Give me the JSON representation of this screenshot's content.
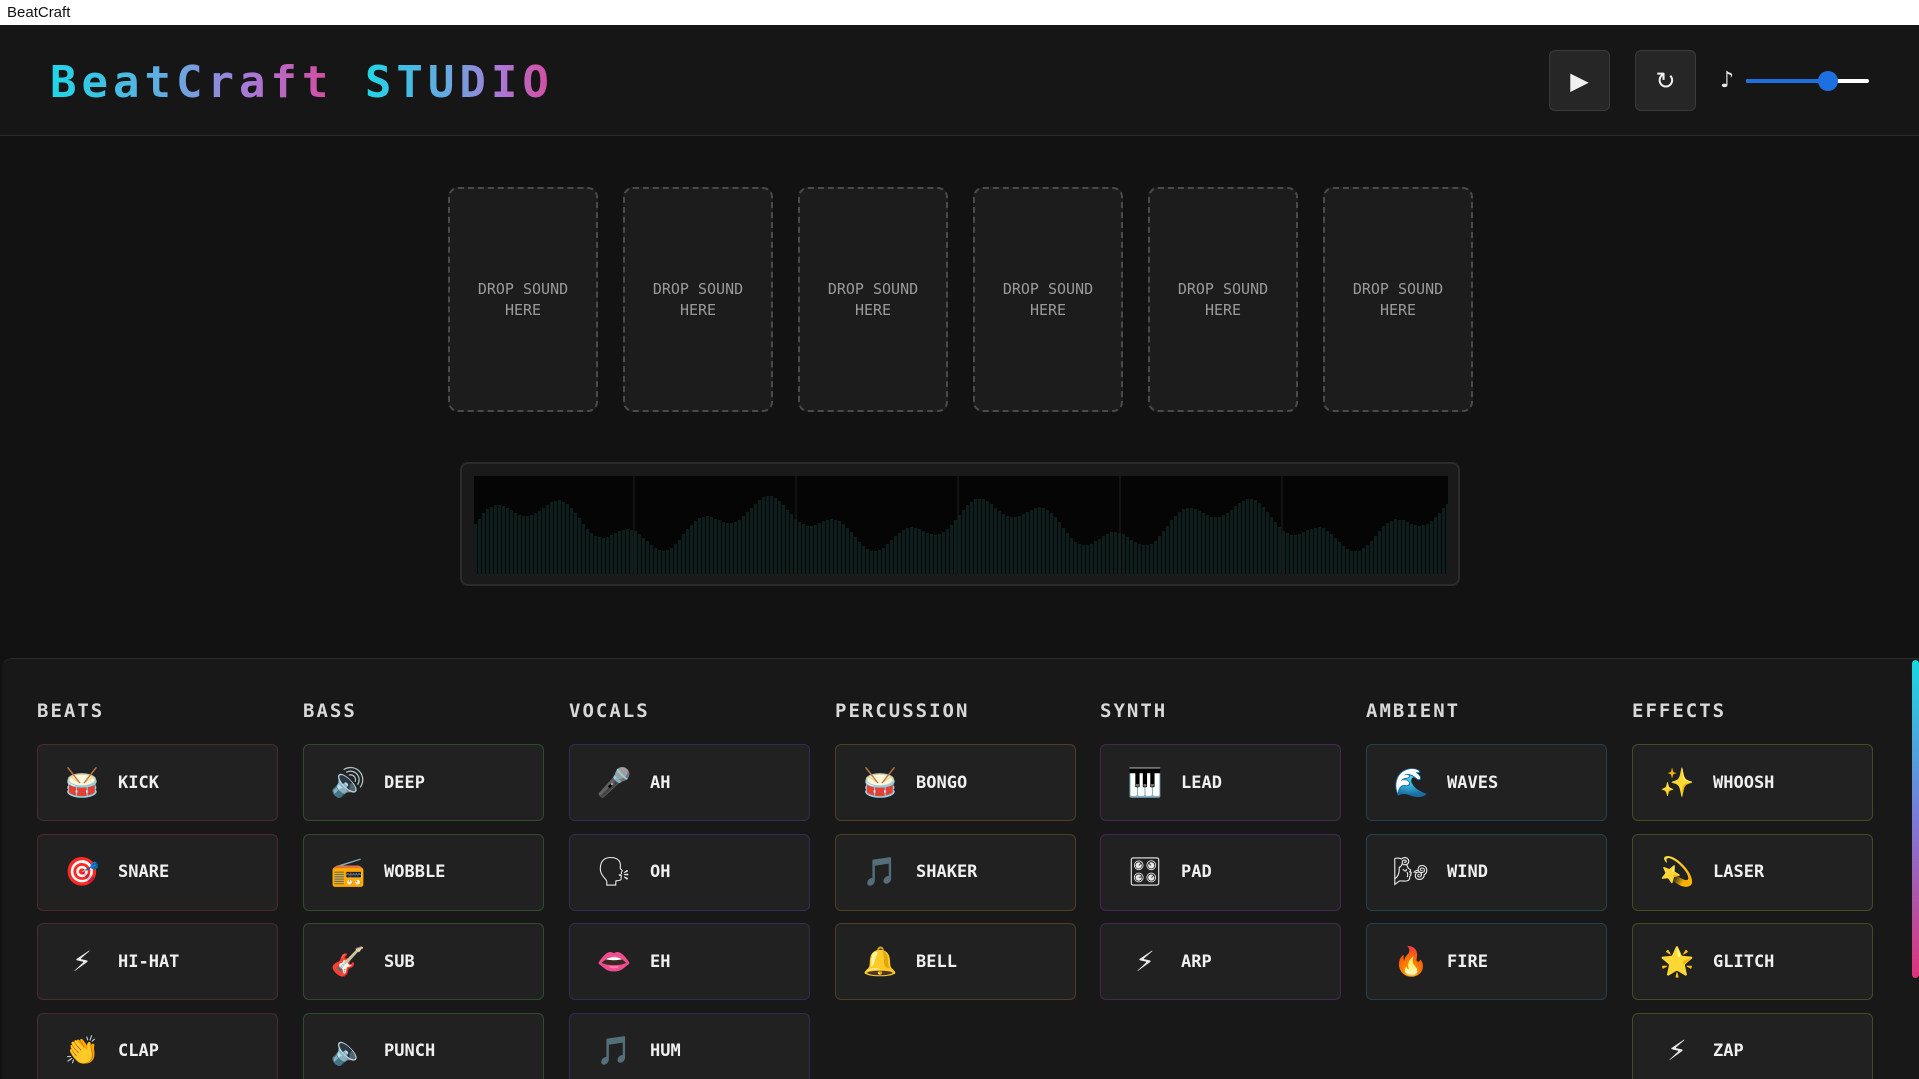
{
  "window": {
    "title": "BeatCraft"
  },
  "header": {
    "logo_part1": "BeatCraft",
    "logo_part2": "STUDIO",
    "play_icon": "▶",
    "reset_icon": "↻",
    "volume_icon": "♪",
    "volume_level": 0.67,
    "accent": "#1e6fe0"
  },
  "slots": [
    {
      "label": "DROP SOUND HERE"
    },
    {
      "label": "DROP SOUND HERE"
    },
    {
      "label": "DROP SOUND HERE"
    },
    {
      "label": "DROP SOUND HERE"
    },
    {
      "label": "DROP SOUND HERE"
    },
    {
      "label": "DROP SOUND HERE"
    }
  ],
  "categories": [
    {
      "title": "BEATS",
      "color": "#4a2b2b",
      "sounds": [
        {
          "label": "KICK",
          "icon": "🥁"
        },
        {
          "label": "SNARE",
          "icon": "🎯"
        },
        {
          "label": "HI-HAT",
          "icon": "⚡"
        },
        {
          "label": "CLAP",
          "icon": "👏"
        }
      ]
    },
    {
      "title": "BASS",
      "color": "#2f4a2f",
      "sounds": [
        {
          "label": "DEEP",
          "icon": "🔊"
        },
        {
          "label": "WOBBLE",
          "icon": "📻"
        },
        {
          "label": "SUB",
          "icon": "🎸"
        },
        {
          "label": "PUNCH",
          "icon": "🔈"
        }
      ]
    },
    {
      "title": "VOCALS",
      "color": "#2e2e52",
      "sounds": [
        {
          "label": "AH",
          "icon": "🎤"
        },
        {
          "label": "OH",
          "icon": "🗣"
        },
        {
          "label": "EH",
          "icon": "👄"
        },
        {
          "label": "HUM",
          "icon": "🎵"
        }
      ]
    },
    {
      "title": "PERCUSSION",
      "color": "#4e3f24",
      "sounds": [
        {
          "label": "BONGO",
          "icon": "🥁"
        },
        {
          "label": "SHAKER",
          "icon": "🎵"
        },
        {
          "label": "BELL",
          "icon": "🔔"
        }
      ]
    },
    {
      "title": "SYNTH",
      "color": "#42294e",
      "sounds": [
        {
          "label": "LEAD",
          "icon": "🎹"
        },
        {
          "label": "PAD",
          "icon": "🎛"
        },
        {
          "label": "ARP",
          "icon": "⚡"
        }
      ]
    },
    {
      "title": "AMBIENT",
      "color": "#25404a",
      "sounds": [
        {
          "label": "WAVES",
          "icon": "🌊"
        },
        {
          "label": "WIND",
          "icon": "🌬"
        },
        {
          "label": "FIRE",
          "icon": "🔥"
        }
      ]
    },
    {
      "title": "EFFECTS",
      "color": "#454a25",
      "sounds": [
        {
          "label": "WHOOSH",
          "icon": "✨"
        },
        {
          "label": "LASER",
          "icon": "💫"
        },
        {
          "label": "GLITCH",
          "icon": "🌟"
        },
        {
          "label": "ZAP",
          "icon": "⚡"
        }
      ]
    }
  ]
}
